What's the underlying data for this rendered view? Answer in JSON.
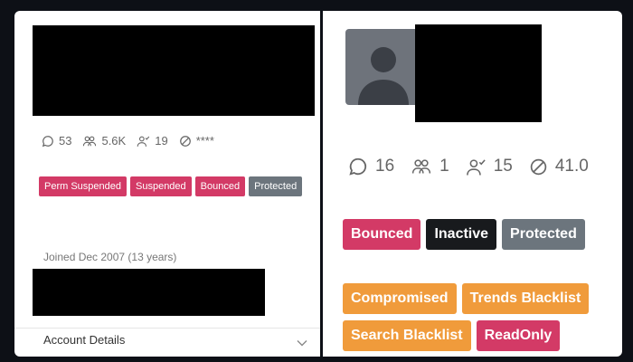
{
  "left_card": {
    "stats": {
      "comments": "53",
      "followers": "5.6K",
      "following": "19",
      "blocked": "****"
    },
    "badges": [
      "Perm Suspended",
      "Suspended",
      "Bounced",
      "Protected"
    ],
    "joined": "Joined Dec 2007 (13 years)",
    "account_details_label": "Account Details"
  },
  "right_card": {
    "stats": {
      "comments": "16",
      "followers": "1",
      "following": "15",
      "blocked": "41.0"
    },
    "badges_row1": [
      "Bounced",
      "Inactive",
      "Protected"
    ],
    "badges_row2": [
      "Compromised",
      "Trends Blacklist"
    ],
    "badges_row3": [
      "Search Blacklist",
      "ReadOnly"
    ]
  },
  "colors": {
    "pink": "#d33a66",
    "gray": "#6c757d",
    "black": "#181a1d",
    "orange": "#f09b3b"
  }
}
